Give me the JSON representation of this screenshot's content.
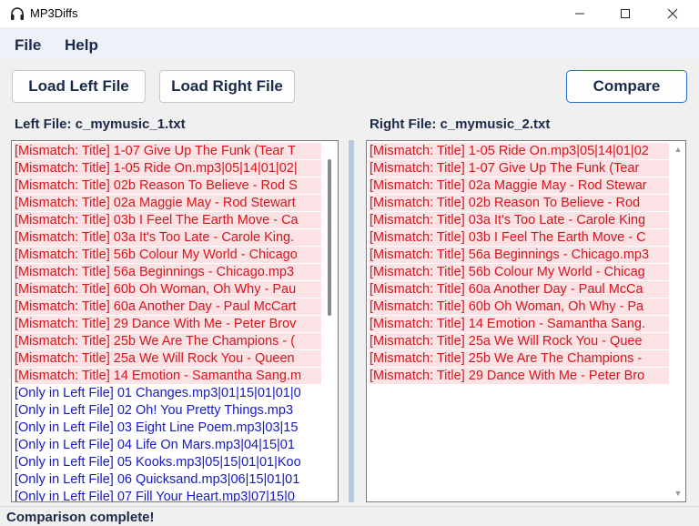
{
  "window": {
    "title": "MP3Diffs",
    "icon": "headphones-icon"
  },
  "menu": {
    "file": "File",
    "help": "Help"
  },
  "toolbar": {
    "load_left": "Load Left File",
    "load_right": "Load Right File",
    "compare": "Compare"
  },
  "left": {
    "label": "Left File: c_mymusic_1.txt",
    "rows": [
      {
        "type": "mismatch",
        "text": "[Mismatch: Title] 1-07 Give Up The Funk (Tear T"
      },
      {
        "type": "mismatch",
        "text": "[Mismatch: Title] 1-05 Ride On.mp3|05|14|01|02|"
      },
      {
        "type": "mismatch",
        "text": "[Mismatch: Title] 02b Reason To Believe - Rod S"
      },
      {
        "type": "mismatch",
        "text": "[Mismatch: Title] 02a Maggie May - Rod Stewart"
      },
      {
        "type": "mismatch",
        "text": "[Mismatch: Title] 03b I Feel The Earth Move - Ca"
      },
      {
        "type": "mismatch",
        "text": "[Mismatch: Title] 03a It's Too Late - Carole King."
      },
      {
        "type": "mismatch",
        "text": "[Mismatch: Title] 56b Colour My World - Chicago"
      },
      {
        "type": "mismatch",
        "text": "[Mismatch: Title] 56a Beginnings - Chicago.mp3"
      },
      {
        "type": "mismatch",
        "text": "[Mismatch: Title] 60b Oh Woman, Oh Why - Pau"
      },
      {
        "type": "mismatch",
        "text": "[Mismatch: Title] 60a Another Day - Paul McCart"
      },
      {
        "type": "mismatch",
        "text": "[Mismatch: Title] 29 Dance With Me - Peter Brov"
      },
      {
        "type": "mismatch",
        "text": "[Mismatch: Title] 25b We Are The Champions - ("
      },
      {
        "type": "mismatch",
        "text": "[Mismatch: Title] 25a We Will Rock You - Queen"
      },
      {
        "type": "mismatch",
        "text": "[Mismatch: Title] 14 Emotion - Samantha Sang.m"
      },
      {
        "type": "only",
        "text": "[Only in Left File] 01 Changes.mp3|01|15|01|01|0"
      },
      {
        "type": "only",
        "text": "[Only in Left File] 02 Oh! You Pretty Things.mp3"
      },
      {
        "type": "only",
        "text": "[Only in Left File] 03 Eight Line Poem.mp3|03|15"
      },
      {
        "type": "only",
        "text": "[Only in Left File] 04 Life On Mars.mp3|04|15|01"
      },
      {
        "type": "only",
        "text": "[Only in Left File] 05 Kooks.mp3|05|15|01|01|Koo"
      },
      {
        "type": "only",
        "text": "[Only in Left File] 06 Quicksand.mp3|06|15|01|01"
      },
      {
        "type": "only",
        "text": "[Only in Left File] 07 Fill Your Heart.mp3|07|15|0"
      }
    ]
  },
  "right": {
    "label": "Right File: c_mymusic_2.txt",
    "rows": [
      {
        "type": "mismatch",
        "text": "[Mismatch: Title] 1-05 Ride On.mp3|05|14|01|02"
      },
      {
        "type": "mismatch",
        "text": "[Mismatch: Title] 1-07 Give Up The Funk (Tear"
      },
      {
        "type": "mismatch",
        "text": "[Mismatch: Title] 02a Maggie May - Rod Stewar"
      },
      {
        "type": "mismatch",
        "text": "[Mismatch: Title] 02b Reason To Believe - Rod"
      },
      {
        "type": "mismatch",
        "text": "[Mismatch: Title] 03a It's Too Late - Carole King"
      },
      {
        "type": "mismatch",
        "text": "[Mismatch: Title] 03b I Feel The Earth Move - C"
      },
      {
        "type": "mismatch",
        "text": "[Mismatch: Title] 56a Beginnings - Chicago.mp3"
      },
      {
        "type": "mismatch",
        "text": "[Mismatch: Title] 56b Colour My World - Chicag"
      },
      {
        "type": "mismatch",
        "text": "[Mismatch: Title] 60a Another Day - Paul McCa"
      },
      {
        "type": "mismatch",
        "text": "[Mismatch: Title] 60b Oh Woman, Oh Why - Pa"
      },
      {
        "type": "mismatch",
        "text": "[Mismatch: Title] 14 Emotion - Samantha Sang."
      },
      {
        "type": "mismatch",
        "text": "[Mismatch: Title] 25a We Will Rock You - Quee"
      },
      {
        "type": "mismatch",
        "text": "[Mismatch: Title] 25b We Are The Champions -"
      },
      {
        "type": "mismatch",
        "text": "[Mismatch: Title] 29 Dance With Me - Peter Bro"
      }
    ]
  },
  "status": {
    "text": "Comparison complete!"
  },
  "colors": {
    "mismatch_text": "#d8141c",
    "mismatch_bg": "#fbe2e4",
    "only_text": "#1518c8",
    "accent": "#2a6fc9"
  }
}
